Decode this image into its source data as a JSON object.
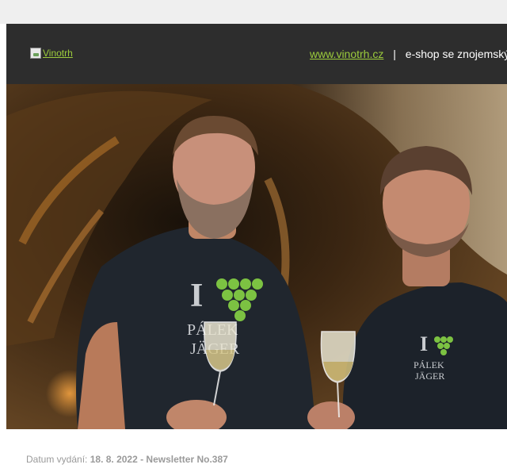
{
  "header": {
    "logo_alt": "Vinotrh",
    "site_link": "www.vinotrh.cz",
    "separator": "|",
    "tagline": "e-shop se znojemský"
  },
  "hero": {
    "shirt_left": {
      "line1": "PÁLEK",
      "line2": "JÄGER"
    },
    "shirt_right": {
      "line1": "PÁLEK",
      "line2": "JÄGER"
    },
    "shirt_heart_letter": "I"
  },
  "footer": {
    "issue_label": "Datum vydání:",
    "issue_value": "18. 8. 2022 - Newsletter No.387"
  },
  "colors": {
    "accent": "#9ccc3c",
    "header_bg": "#2d2d2d",
    "grape": "#7cc242"
  }
}
